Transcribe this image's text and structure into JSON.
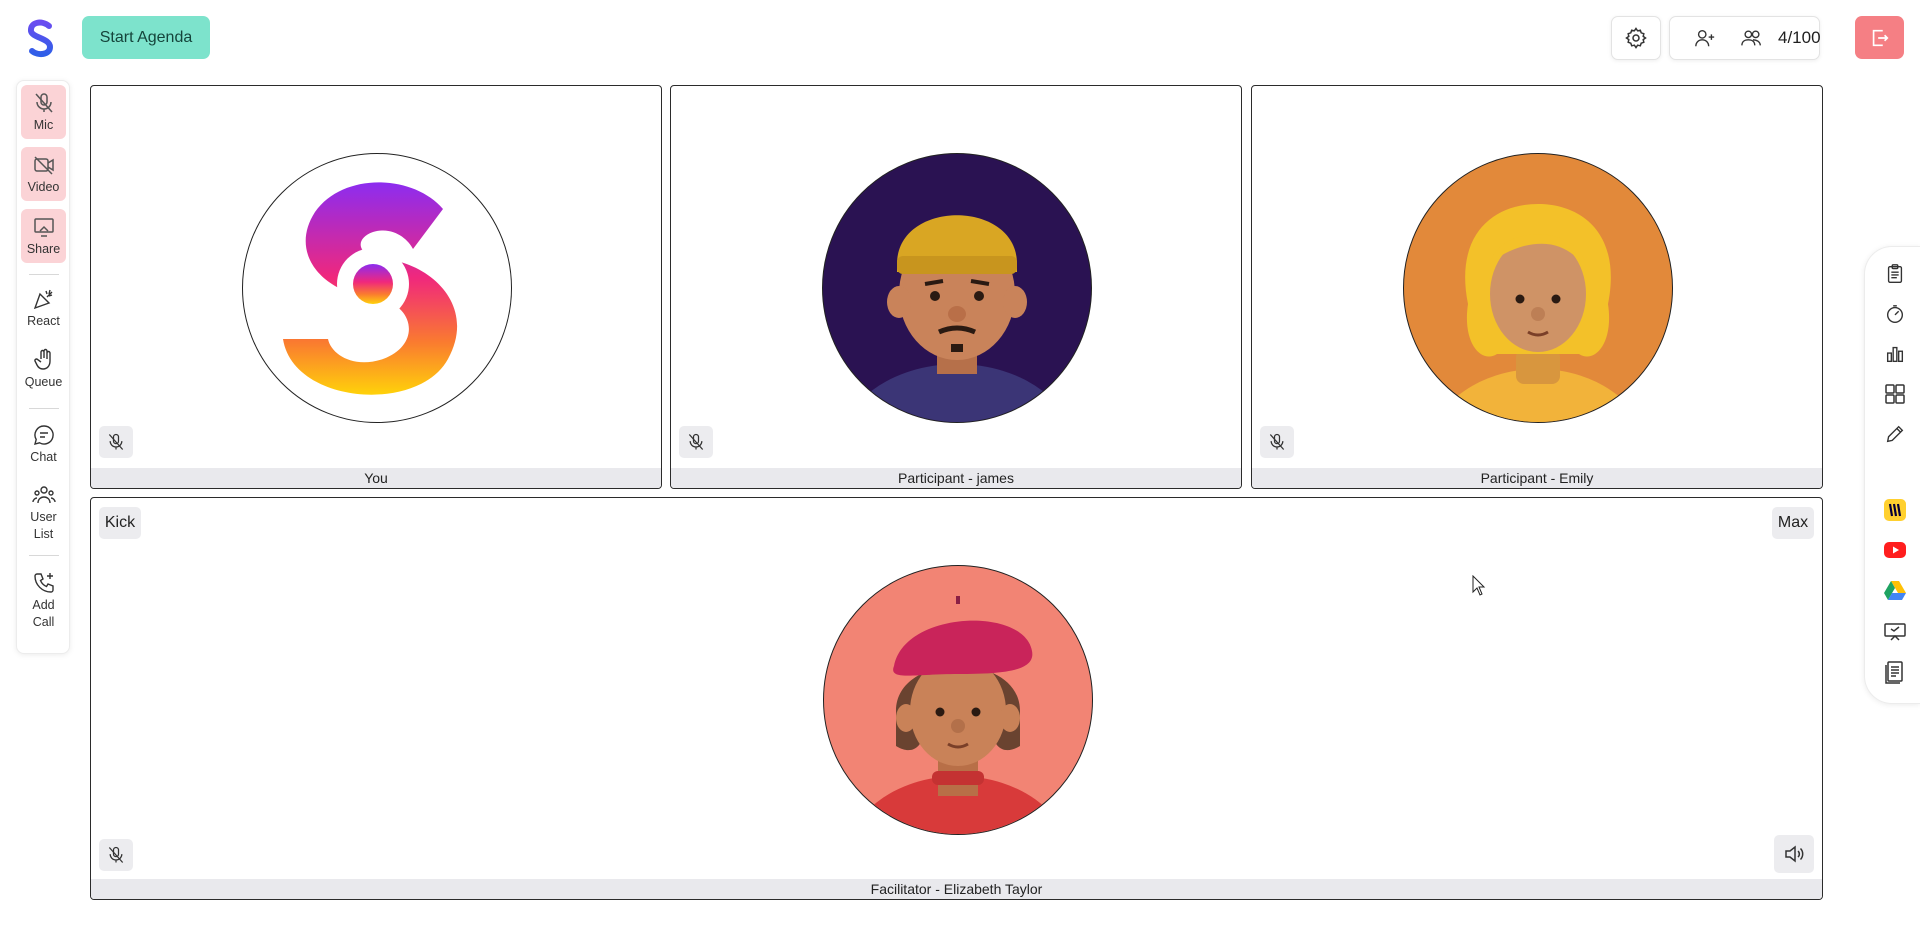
{
  "topbar": {
    "start_agenda_label": "Start Agenda",
    "participant_count": "4/100",
    "colors": {
      "accent": "#7de3cc",
      "leave": "#f57f84"
    }
  },
  "left_toolbar": {
    "mic_label": "Mic",
    "video_label": "Video",
    "share_label": "Share",
    "react_label": "React",
    "queue_label": "Queue",
    "chat_label": "Chat",
    "user_list_label": "User List",
    "add_call_label": "Add Call",
    "active_color": "#fbd3d6"
  },
  "tiles": [
    {
      "name": "You"
    },
    {
      "name": "Participant - james"
    },
    {
      "name": "Participant - Emily"
    }
  ],
  "facilitator_tile": {
    "name": "Facilitator - Elizabeth Taylor",
    "kick_label": "Kick",
    "max_label": "Max"
  },
  "right_toolbar": {
    "icons": [
      "agenda-icon",
      "timer-icon",
      "poll-icon",
      "apps-grid-icon",
      "pencil-icon",
      "miro-icon",
      "youtube-icon",
      "google-drive-icon",
      "presentation-icon",
      "document-icon"
    ]
  }
}
